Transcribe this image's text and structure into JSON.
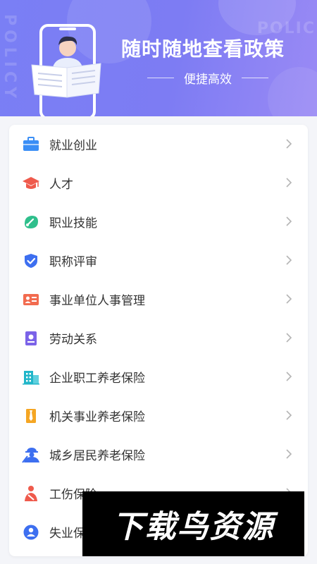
{
  "banner": {
    "title": "随时随地查看政策",
    "subtitle": "便捷高效",
    "watermark_left": "POLICY",
    "watermark_right": "POLIC"
  },
  "menu": {
    "items": [
      {
        "label": "就业创业",
        "icon": "briefcase-icon",
        "color": "#3a8ef6"
      },
      {
        "label": "人才",
        "icon": "graduation-cap-icon",
        "color": "#ef5a4c"
      },
      {
        "label": "职业技能",
        "icon": "skill-badge-icon",
        "color": "#2fbf8c"
      },
      {
        "label": "职称评审",
        "icon": "shield-check-icon",
        "color": "#3d6ff0"
      },
      {
        "label": "事业单位人事管理",
        "icon": "id-card-icon",
        "color": "#f26b4f"
      },
      {
        "label": "劳动关系",
        "icon": "contract-icon",
        "color": "#7b63e8"
      },
      {
        "label": "企业职工养老保险",
        "icon": "building-icon",
        "color": "#21b6c9"
      },
      {
        "label": "机关事业养老保险",
        "icon": "tie-icon",
        "color": "#f5a623"
      },
      {
        "label": "城乡居民养老保险",
        "icon": "worker-icon",
        "color": "#3d6ff0"
      },
      {
        "label": "工伤保险",
        "icon": "injured-person-icon",
        "color": "#ef5a4c"
      },
      {
        "label": "失业保险",
        "icon": "person-circle-icon",
        "color": "#3d6ff0"
      }
    ]
  },
  "overlay_watermark": "下载鸟资源"
}
